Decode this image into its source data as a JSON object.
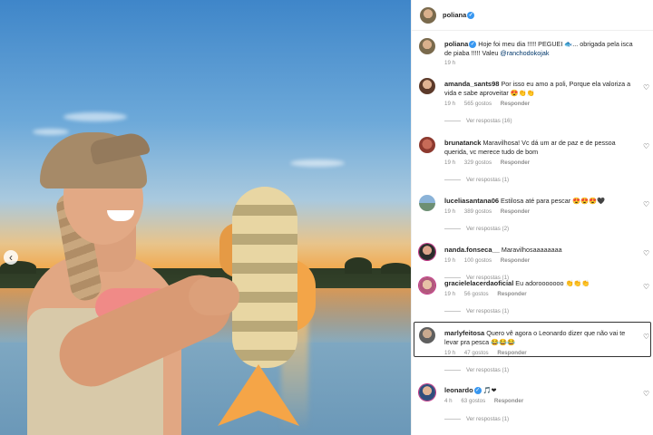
{
  "post": {
    "author": "poliana",
    "carousel_prev": "‹"
  },
  "caption": {
    "username": "poliana",
    "text": "Hoje foi meu dia !!!!! PEGUEI 🐟... obrigada pela isca de piaba !!!!! Valeu",
    "mention": "@ranchodokojak",
    "time": "19 h"
  },
  "comments": [
    {
      "username": "amanda_sants98",
      "text": "Por isso eu amo a poli, Porque ela valoriza a vida e sabe aproveitar 😍👏👏",
      "time": "19 h",
      "likes": "565 gostos",
      "reply": "Responder",
      "view_replies": "Ver respostas (16)"
    },
    {
      "username": "brunatanck",
      "text": "Maravilhosa! Vc dá um ar de paz e de pessoa querida, vc merece tudo de bom",
      "time": "19 h",
      "likes": "329 gostos",
      "reply": "Responder",
      "view_replies": "Ver respostas (1)"
    },
    {
      "username": "luceliasantana06",
      "text": "Estilosa até para pescar 😍😍😍🖤",
      "time": "19 h",
      "likes": "389 gostos",
      "reply": "Responder",
      "view_replies": "Ver respostas (2)"
    },
    {
      "username": "nanda.fonseca__",
      "text": "Maravilhosaaaaaaaa",
      "time": "19 h",
      "likes": "100 gostos",
      "reply": "Responder",
      "view_replies": "Ver respostas (1)"
    },
    {
      "username": "gracielelacerdaoficial",
      "text": "Eu adorooooooo 👏👏👏",
      "time": "19 h",
      "likes": "56 gostos",
      "reply": "Responder",
      "view_replies": "Ver respostas (1)"
    },
    {
      "username": "marlyfeitosa",
      "text": "Quero vê agora o Leonardo dizer que não vai te levar pra pesca 😂😂😂",
      "time": "19 h",
      "likes": "47 gostos",
      "reply": "Responder",
      "view_replies": "Ver respostas (1)"
    },
    {
      "username": "leonardo",
      "text": "🎵❤",
      "time": "4 h",
      "likes": "63 gostos",
      "reply": "Responder",
      "view_replies": "Ver respostas (1)"
    }
  ],
  "icons": {
    "verified": "✓",
    "heart": "♡"
  }
}
